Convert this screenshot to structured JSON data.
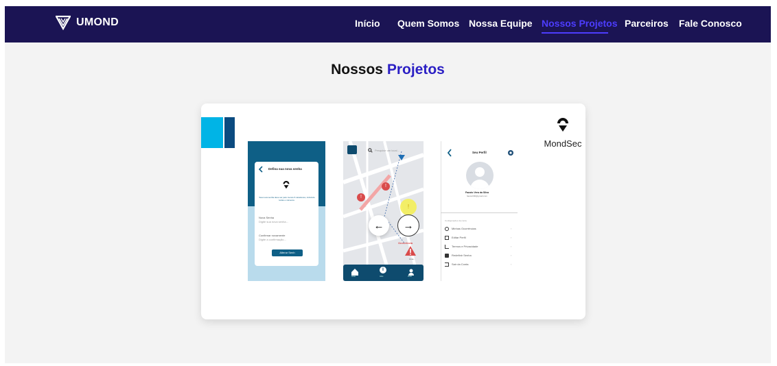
{
  "brand": {
    "name": "UMOND"
  },
  "nav": {
    "items": [
      {
        "label": "Início"
      },
      {
        "label": "Quem Somos"
      },
      {
        "label": "Nossa Equipe"
      },
      {
        "label": "Nossos Projetos"
      },
      {
        "label": "Parceiros"
      },
      {
        "label": "Fale Conosco"
      }
    ],
    "active_index": 3,
    "active_color": "#4d3dff",
    "bg_color": "#1b1454"
  },
  "section": {
    "title_part1": "Nossos",
    "title_part2": "Projetos",
    "accent_color": "#2b1fc4"
  },
  "project": {
    "name": "MondSec",
    "screen_reset": {
      "heading": "Defina sua nova senha",
      "info": "Sua nova senha deve ser pelo menos 6 caracteres, incluindo letras e números.",
      "new_label": "Nova Senha",
      "new_placeholder": "Digite sua nova senha...",
      "confirm_label": "Confirmar novamente",
      "confirm_placeholder": "Digite a confirmação...",
      "button": "Alterar Senh"
    },
    "screen_map": {
      "search_placeholder": "Pesquise um local...",
      "alert_label": "Ocorrência",
      "alert_sub": "Uma...",
      "tab_home": "Início",
      "tab_info": "Infos",
      "tab_profile": "Perfil"
    },
    "screen_profile": {
      "title": "Seu Perfil",
      "user_name": "Fausto Vera da Silva",
      "user_email": "fausto000@gmail.com",
      "section_label": "Configurações da conta",
      "menu": [
        {
          "label": "Minhas Ocorrências"
        },
        {
          "label": "Editar Perfil"
        },
        {
          "label": "Termos e Privacidade"
        },
        {
          "label": "Redefinir Senha"
        },
        {
          "label": "Sair da Conta"
        }
      ]
    }
  },
  "carousel": {
    "prev": "←",
    "next": "→"
  }
}
